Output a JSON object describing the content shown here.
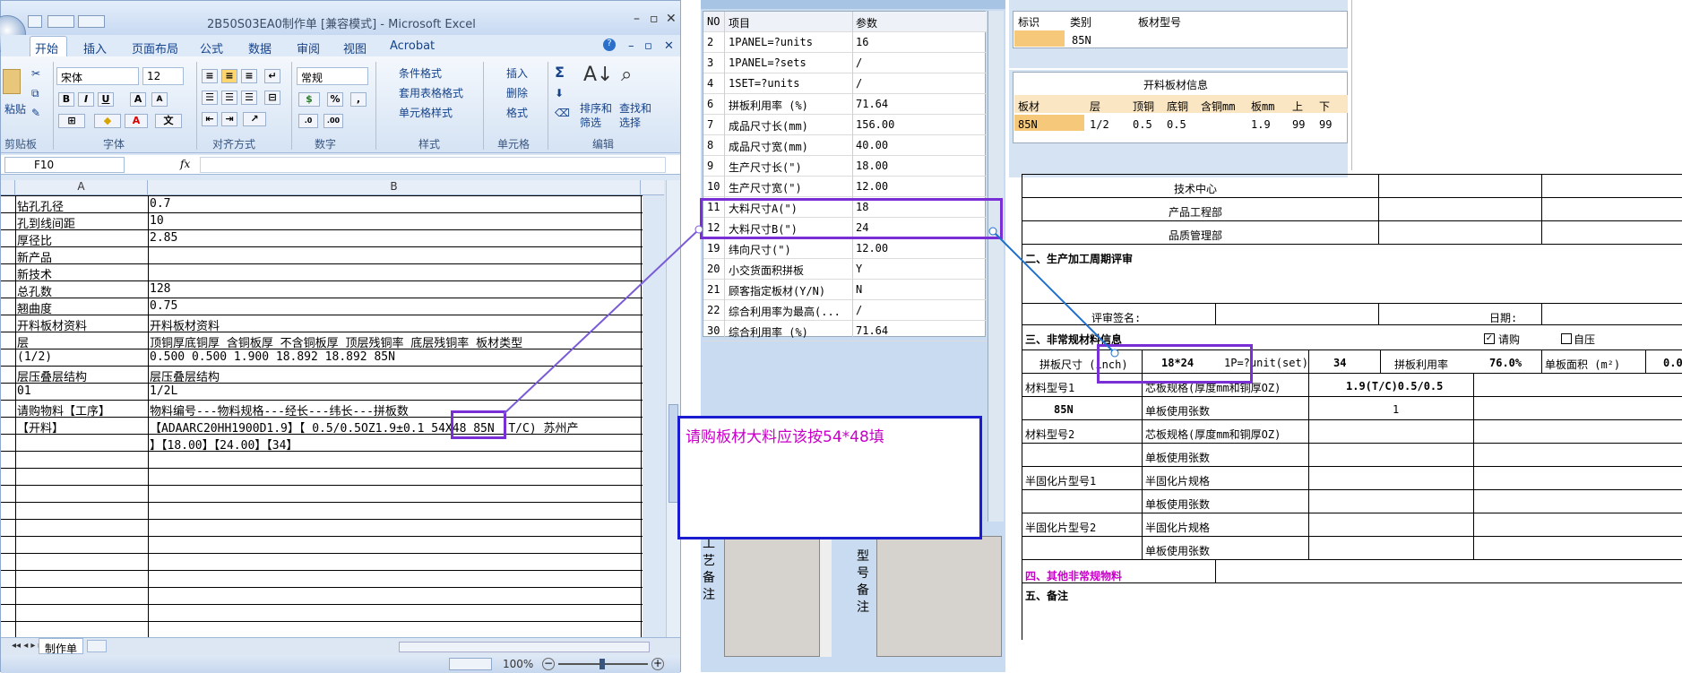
{
  "excel": {
    "title": "2B50S03EA0制作单 [兼容模式] - Microsoft Excel",
    "tabs": [
      "开始",
      "插入",
      "页面布局",
      "公式",
      "数据",
      "审阅",
      "视图",
      "Acrobat"
    ],
    "font_name": "宋体",
    "font_size": "12",
    "number_format": "常规",
    "paste_label": "粘贴",
    "groups": [
      "剪贴板",
      "字体",
      "对齐方式",
      "数字",
      "样式",
      "单元格",
      "编辑"
    ],
    "style_buttons": [
      "条件格式",
      "套用表格格式",
      "单元格样式"
    ],
    "cell_buttons": [
      "插入",
      "删除",
      "格式"
    ],
    "edit_buttons": [
      "排序和筛选",
      "查找和选择"
    ],
    "name_box": "F10",
    "fx": "fx",
    "col_a": "A",
    "col_b": "B",
    "rows": [
      {
        "a": "钻孔孔径",
        "b": "0.7"
      },
      {
        "a": "孔到线间距",
        "b": "10"
      },
      {
        "a": "厚径比",
        "b": "2.85"
      },
      {
        "a": "新产品",
        "b": ""
      },
      {
        "a": "新技术",
        "b": ""
      },
      {
        "a": "总孔数",
        "b": "128"
      },
      {
        "a": "翘曲度",
        "b": "0.75"
      },
      {
        "a": "开料板材资料",
        "b": "开料板材资料"
      },
      {
        "a": "层",
        "b": "顶铜厚底铜厚 含铜板厚 不含铜板厚 顶层残铜率 底层残铜率 板材类型"
      },
      {
        "a": "(1/2)",
        "b": "0.500  0.500        1.900      18.892     18.892       85N"
      },
      {
        "a": "层压叠层结构",
        "b": "层压叠层结构"
      },
      {
        "a": "01",
        "b": "1/2L"
      },
      {
        "a": "请购物料【工序】",
        "b": "物料编号---物料规格---经长---纬长---拼板数"
      },
      {
        "a": "【开料】",
        "b": "【ADAARC20HH1900D1.9】【 0.5/0.5OZ1.9±0.1 54X48  85N (T/C) 苏州产"
      },
      {
        "a": "",
        "b": "】【18.00】【24.00】【34】"
      }
    ],
    "sheet_tab": "制作单",
    "zoom": "100%"
  },
  "mid": {
    "headers": [
      "NO",
      "项目",
      "参数"
    ],
    "rows": [
      {
        "no": "2",
        "item": "1PANEL=?units",
        "val": "16"
      },
      {
        "no": "3",
        "item": "1PANEL=?sets",
        "val": "/"
      },
      {
        "no": "4",
        "item": "1SET=?units",
        "val": "/"
      },
      {
        "no": "6",
        "item": "拼板利用率 (%)",
        "val": "71.64"
      },
      {
        "no": "7",
        "item": "成品尺寸长(mm)",
        "val": "156.00"
      },
      {
        "no": "8",
        "item": "成品尺寸宽(mm)",
        "val": "40.00"
      },
      {
        "no": "9",
        "item": "生产尺寸长(\")",
        "val": "18.00"
      },
      {
        "no": "10",
        "item": "生产尺寸宽(\")",
        "val": "12.00"
      },
      {
        "no": "11",
        "item": "大料尺寸A(\")",
        "val": "18"
      },
      {
        "no": "12",
        "item": "大料尺寸B(\")",
        "val": "24"
      },
      {
        "no": "19",
        "item": "纬向尺寸(\")",
        "val": "12.00"
      },
      {
        "no": "20",
        "item": "小交货面积拼板",
        "val": "Y"
      },
      {
        "no": "21",
        "item": "顾客指定板材(Y/N)",
        "val": "N"
      },
      {
        "no": "22",
        "item": "综合利用率为最高(...",
        "val": "/"
      },
      {
        "no": "30",
        "item": "综合利用率 (%)",
        "val": "71.64"
      }
    ],
    "note1": "工艺备注",
    "note2": "型号备注"
  },
  "callout": "请购板材大料应该按54*48填",
  "right": {
    "top_headers": [
      "标识",
      "类别",
      "板材型号"
    ],
    "top_row": [
      "",
      "85N",
      ""
    ],
    "board_title": "开料板材信息",
    "board_headers": [
      "板材",
      "层",
      "顶铜",
      "底铜",
      "含铜mm",
      "板mm",
      "上",
      "下"
    ],
    "board_row": [
      "85N",
      "1/2",
      "0.5",
      "0.5",
      "",
      "1.9",
      "99",
      "99"
    ],
    "depts": [
      "技术中心",
      "产品工程部",
      "品质管理部"
    ],
    "sec2": "二、生产加工周期评审",
    "sign": "评审签名:",
    "date": "日期:",
    "sec3": "三、非常规材料信息",
    "buy": "请购",
    "press": "自压",
    "panel_size_lbl": "拼板尺寸 (inch)",
    "panel_size": "18*24",
    "ip_lbl": "1P=?unit(set)",
    "ip_val": "34",
    "util_lbl": "拼板利用率",
    "util_val": "76.0%",
    "area_lbl": "单板面积 (m²)",
    "area_val": "0.0",
    "mat1": "材料型号1",
    "core_spec": "芯板规格(厚度mm和铜厚OZ)",
    "core_val": "1.9(T/C)0.5/0.5",
    "mat1_val": "85N",
    "sheets": "单板使用张数",
    "sheets_val": "1",
    "mat2": "材料型号2",
    "semi1": "半固化片型号1",
    "semi_spec": "半固化片规格",
    "semi2": "半固化片型号2",
    "sec4": "四、其他非常规物料",
    "sec5": "五、备注"
  },
  "colors": {
    "purple": "#7a2fd6",
    "blue": "#1b1bd0",
    "magenta": "#c800c8",
    "link": "#1f6fcf"
  }
}
